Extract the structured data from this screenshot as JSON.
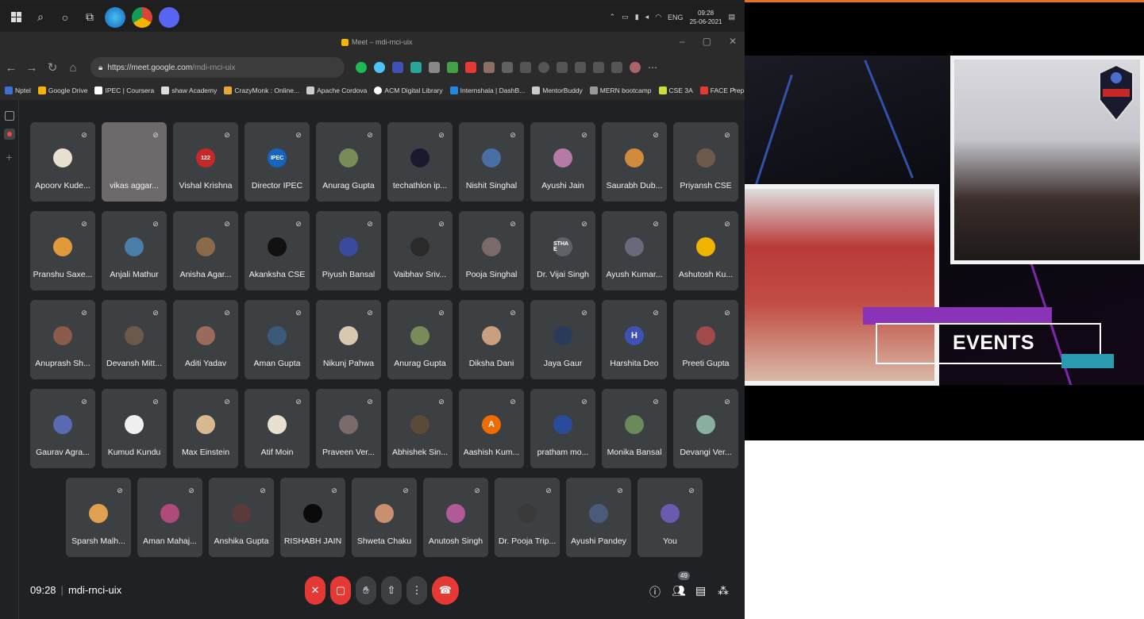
{
  "taskbar": {
    "icons": [
      "windows-icon",
      "search-icon",
      "cortana-icon",
      "task-view-icon",
      "edge-icon",
      "chrome-icon",
      "discord-icon"
    ],
    "tray": {
      "language": "ENG",
      "time": "09:28",
      "date": "25-06-2021"
    }
  },
  "browser": {
    "tab_title": "Meet – mdi-rnci-uix",
    "url_host": "https://meet.google.com",
    "url_path": "/mdi-rnci-uix",
    "bookmarks": [
      "Nptel",
      "Google Drive",
      "IPEC | Coursera",
      "shaw Academy",
      "CrazyMonk : Online...",
      "Apache Cordova",
      "ACM Digital Library",
      "Internshala | DashB...",
      "MentorBuddy",
      "MERN bootcamp",
      "CSE 3A",
      "FACE Prep"
    ]
  },
  "meet": {
    "participants": [
      {
        "name": "Apoorv Kude...",
        "color": "#e8e0d0"
      },
      {
        "name": "vikas aggar...",
        "color": ""
      },
      {
        "name": "Vishal Krishna",
        "color": "#c62828",
        "initials": "122"
      },
      {
        "name": "Director IPEC",
        "color": "#1565c0",
        "initials": "IPEC"
      },
      {
        "name": "Anurag Gupta",
        "color": "#7a8b5a"
      },
      {
        "name": "techathlon ip...",
        "color": "#1a1a2e"
      },
      {
        "name": "Nishit Singhal",
        "color": "#4a6fa5"
      },
      {
        "name": "Ayushi Jain",
        "color": "#b57ba6"
      },
      {
        "name": "Saurabh Dub...",
        "color": "#d28a3c"
      },
      {
        "name": "Priyansh CSE",
        "color": "#6d5a4a"
      },
      {
        "name": "Pranshu Saxe...",
        "color": "#e09a3c"
      },
      {
        "name": "Anjali Mathur",
        "color": "#4a7ea8"
      },
      {
        "name": "Anisha Agar...",
        "color": "#8a6a4a"
      },
      {
        "name": "Akanksha CSE",
        "color": "#111111"
      },
      {
        "name": "Piyush Bansal",
        "color": "#3a4aa0"
      },
      {
        "name": "Vaibhav Sriv...",
        "color": "#2a2a2a"
      },
      {
        "name": "Pooja Singhal",
        "color": "#7a6a6a"
      },
      {
        "name": "Dr. Vijai Singh",
        "color": "#5f6368",
        "initials": "STHA E"
      },
      {
        "name": "Ayush Kumar...",
        "color": "#6a6a7a"
      },
      {
        "name": "Ashutosh Ku...",
        "color": "#f0b400"
      },
      {
        "name": "Anuprash Sh...",
        "color": "#8a5a4a"
      },
      {
        "name": "Devansh Mitt...",
        "color": "#6a5a4a"
      },
      {
        "name": "Aditi Yadav",
        "color": "#9a6a5a"
      },
      {
        "name": "Aman Gupta",
        "color": "#3a5a7a"
      },
      {
        "name": "Nikunj Pahwa",
        "color": "#d8c8b0"
      },
      {
        "name": "Anurag Gupta",
        "color": "#7a8b5a"
      },
      {
        "name": "Diksha Dani",
        "color": "#c8a080"
      },
      {
        "name": "Jaya Gaur",
        "color": "#2a3a5a"
      },
      {
        "name": "Harshita Deo",
        "color": "#3f51b5",
        "initials": "H"
      },
      {
        "name": "Preeti Gupta",
        "color": "#a04a4a"
      },
      {
        "name": "Gaurav Agra...",
        "color": "#5a6ab0"
      },
      {
        "name": "Kumud Kundu",
        "color": "#f0f0f0"
      },
      {
        "name": "Max Einstein",
        "color": "#d8b890"
      },
      {
        "name": "Atif Moin",
        "color": "#e8e0d0"
      },
      {
        "name": "Praveen Ver...",
        "color": "#7a6a6a"
      },
      {
        "name": "Abhishek Sin...",
        "color": "#5a4a3a"
      },
      {
        "name": "Aashish Kum...",
        "color": "#ef6c00",
        "initials": "A"
      },
      {
        "name": "pratham mo...",
        "color": "#2a4a9a"
      },
      {
        "name": "Monika Bansal",
        "color": "#6a8a5a"
      },
      {
        "name": "Devangi Ver...",
        "color": "#8ab0a0"
      },
      {
        "name": "Sparsh Malh...",
        "color": "#e0a050"
      },
      {
        "name": "Aman Mahaj...",
        "color": "#b04a7a"
      },
      {
        "name": "Anshika Gupta",
        "color": "#5a3a3a"
      },
      {
        "name": "RISHABH JAIN",
        "color": "#0a0a0a"
      },
      {
        "name": "Shweta Chaku",
        "color": "#c89070"
      },
      {
        "name": "Anutosh Singh",
        "color": "#b05a9a"
      },
      {
        "name": "Dr. Pooja Trip...",
        "color": "#3a3a3a"
      },
      {
        "name": "Ayushi Pandey",
        "color": "#4a5a7a"
      },
      {
        "name": "You",
        "color": "#6a5ab0"
      }
    ],
    "meeting_time": "09:28",
    "meeting_code": "mdi-rnci-uix",
    "participant_count": "49"
  },
  "presentation": {
    "banner_text": "EVENTS",
    "colors": {
      "bar": "#8a33b8",
      "teal": "#2a9bb0"
    }
  }
}
